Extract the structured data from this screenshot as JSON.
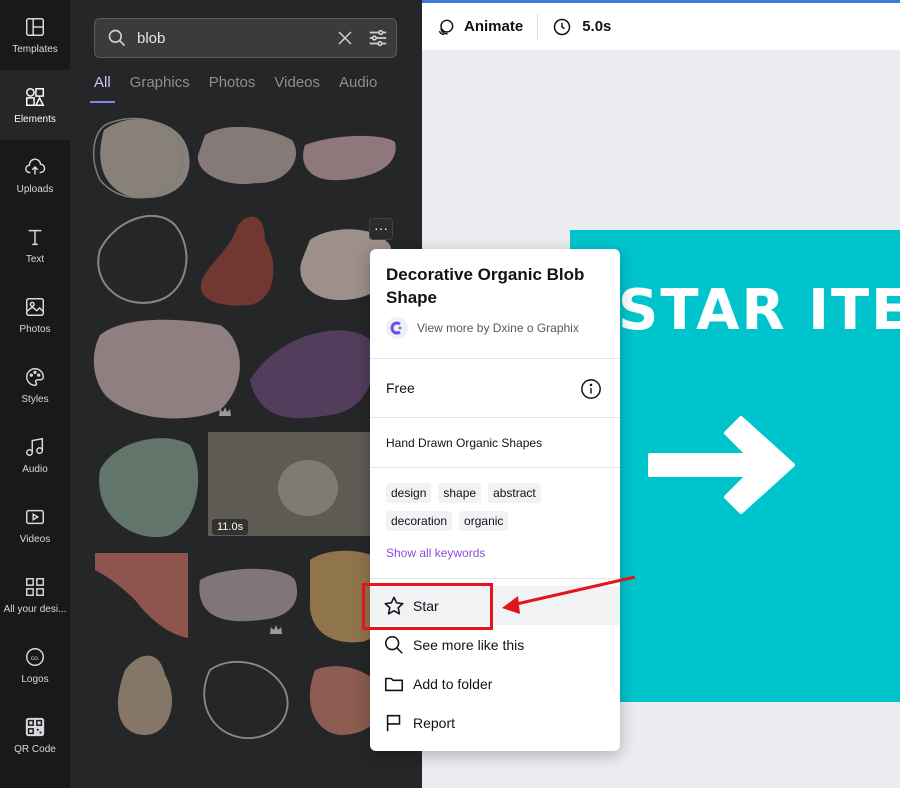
{
  "rail": [
    {
      "label": "Templates",
      "icon": "templates-icon"
    },
    {
      "label": "Elements",
      "icon": "elements-icon",
      "active": true
    },
    {
      "label": "Uploads",
      "icon": "uploads-icon"
    },
    {
      "label": "Text",
      "icon": "text-icon"
    },
    {
      "label": "Photos",
      "icon": "photos-icon"
    },
    {
      "label": "Styles",
      "icon": "styles-icon"
    },
    {
      "label": "Audio",
      "icon": "audio-icon"
    },
    {
      "label": "Videos",
      "icon": "videos-icon"
    },
    {
      "label": "All your desi...",
      "icon": "all-designs-icon"
    },
    {
      "label": "Logos",
      "icon": "logos-icon"
    },
    {
      "label": "QR Code",
      "icon": "qr-code-icon"
    }
  ],
  "search": {
    "value": "blob"
  },
  "tabs": [
    "All",
    "Graphics",
    "Photos",
    "Videos",
    "Audio"
  ],
  "grid": {
    "video_time": "11.0s"
  },
  "topbar": {
    "animate_label": "Animate",
    "duration": "5.0s"
  },
  "design": {
    "title_text": "STAR ITE"
  },
  "popup": {
    "title": "Decorative Organic Blob Shape",
    "author": "View more by Dxine o Graphix",
    "license": "Free",
    "collection": "Hand Drawn Organic Shapes",
    "keywords": [
      "design",
      "shape",
      "abstract",
      "decoration",
      "organic"
    ],
    "show_keywords": "Show all keywords",
    "menu": [
      {
        "label": "Star",
        "icon": "star-icon"
      },
      {
        "label": "See more like this",
        "icon": "search-icon"
      },
      {
        "label": "Add to folder",
        "icon": "folder-icon"
      },
      {
        "label": "Report",
        "icon": "flag-icon"
      }
    ]
  },
  "colors": {
    "accent": "#8b7ff5",
    "canvas": "#00c4cc",
    "annotation": "#e3141c",
    "link": "#8b4fd9"
  }
}
